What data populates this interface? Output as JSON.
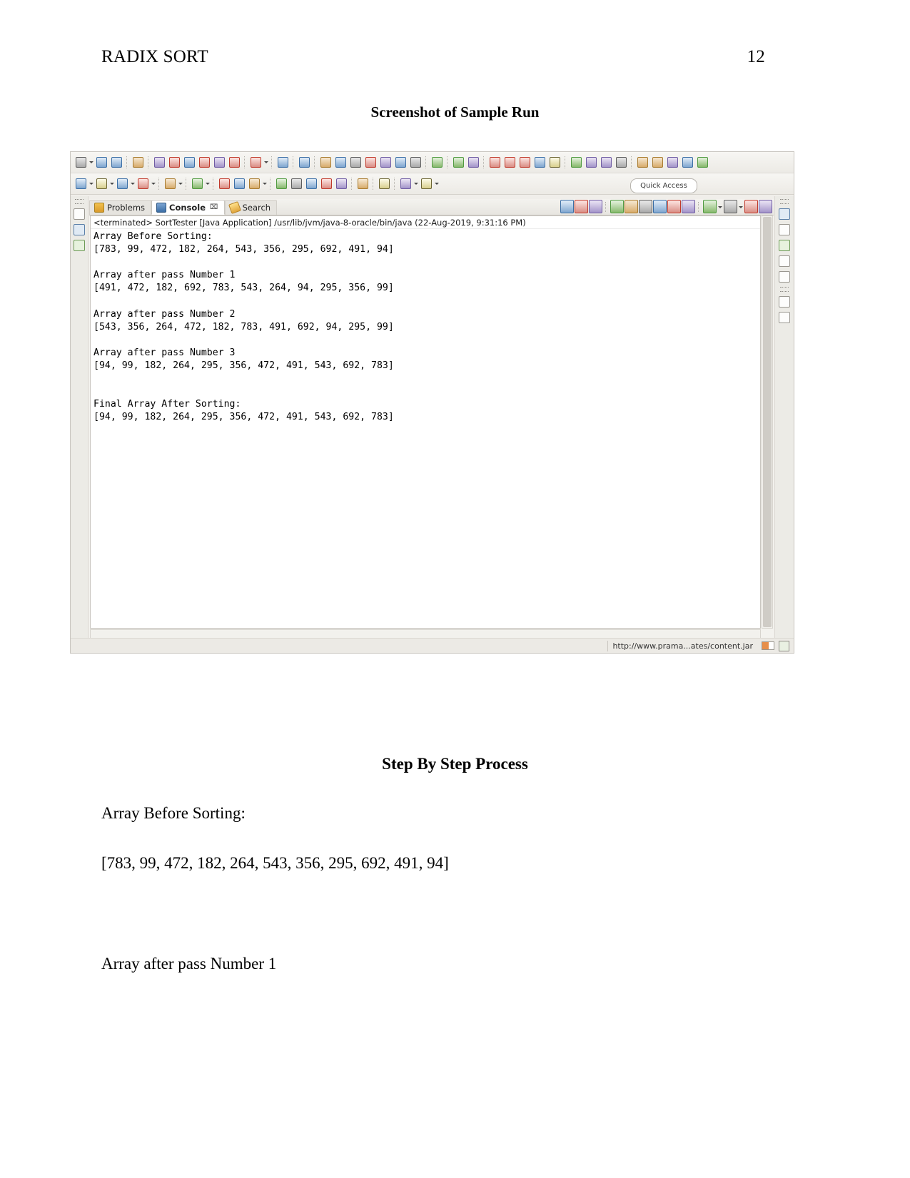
{
  "document": {
    "header": {
      "running_head": "RADIX SORT",
      "page_number": "12"
    },
    "headings": {
      "screenshot": "Screenshot of Sample Run",
      "steps": "Step By Step Process"
    },
    "body": {
      "array_before_label": "Array Before Sorting:",
      "array_before_value": "[783, 99, 472, 182, 264, 543, 356, 295, 692, 491, 94]",
      "pass1_label": "Array after pass Number 1"
    }
  },
  "ide": {
    "quick_access": "Quick Access",
    "tabs": [
      {
        "label": "Problems",
        "icon": "problems-icon",
        "active": false,
        "closable": false
      },
      {
        "label": "Console",
        "icon": "console-icon",
        "active": true,
        "closable": true,
        "close_glyph": "⌧"
      },
      {
        "label": "Search",
        "icon": "search-icon",
        "active": false,
        "closable": false
      }
    ],
    "console": {
      "launch_line": "<terminated> SortTester [Java Application] /usr/lib/jvm/java-8-oracle/bin/java (22-Aug-2019, 9:31:16 PM)",
      "output": "Array Before Sorting:\n[783, 99, 472, 182, 264, 543, 356, 295, 692, 491, 94]\n\nArray after pass Number 1\n[491, 472, 182, 692, 783, 543, 264, 94, 295, 356, 99]\n\nArray after pass Number 2\n[543, 356, 264, 472, 182, 783, 491, 692, 94, 295, 99]\n\nArray after pass Number 3\n[94, 99, 182, 264, 295, 356, 472, 491, 543, 692, 783]\n\n\nFinal Array After Sorting:\n[94, 99, 182, 264, 295, 356, 472, 491, 543, 692, 783]"
    },
    "status": {
      "text": "http://www.prama...ates/content.jar"
    },
    "colors": {
      "toolbar_bg": "#f2f0ec",
      "view_bg": "#f3f2ee",
      "console_bg": "#ffffff",
      "tab_active_bg": "#ffffff",
      "accent_green": "#4f9a3f",
      "accent_red": "#c0392b",
      "accent_blue": "#3b6ea5",
      "accent_orange": "#e78f4a"
    },
    "toolbar_row1_icons": [
      "new-file-icon",
      "dropdown-arrow",
      "save-icon",
      "save-all-icon",
      "sep",
      "print-icon",
      "sep",
      "refresh-icon",
      "build-all-icon",
      "info-icon",
      "properties-icon",
      "new-java-project-icon",
      "new-java-ee-icon",
      "sep",
      "debug-person-icon",
      "dropdown-arrow",
      "sep",
      "terminal-icon",
      "sep",
      "skip-breakpoints-icon",
      "sep",
      "resume-icon",
      "suspend-icon",
      "terminate-icon",
      "disconnect-icon",
      "step-into-icon",
      "step-over-icon",
      "step-return-icon",
      "sep",
      "toggle-wordwrap-icon",
      "sep",
      "open-type-icon",
      "open-task-icon",
      "sep",
      "next-annotation-icon",
      "previous-annotation-icon",
      "last-edit-icon",
      "back-icon",
      "forward-icon",
      "sep",
      "pin-icon",
      "tag-icon",
      "warning-icon",
      "error-icon",
      "sep",
      "link-icon",
      "collapse-icon",
      "expand-icon",
      "filter-icon",
      "sort-icon"
    ],
    "toolbar_row2_icons": [
      "new-wizard-icon",
      "dropdown-arrow",
      "run-icon",
      "dropdown-arrow",
      "debug-icon",
      "dropdown-arrow",
      "coverage-icon",
      "dropdown-arrow",
      "sep",
      "external-tools-icon",
      "dropdown-arrow",
      "sep",
      "git-icon",
      "dropdown-arrow",
      "sep",
      "open-perspective-icon",
      "open-folder-icon",
      "edit-icon",
      "dropdown-arrow",
      "sep",
      "history-icon",
      "run-last-icon",
      "compare-icon",
      "report-icon",
      "table-icon",
      "sep",
      "search-globe-icon",
      "sep",
      "next-edit-icon",
      "sep",
      "back-nav-icon",
      "dropdown-arrow",
      "forward-nav-icon",
      "dropdown-arrow"
    ],
    "view_toolbar_icons": [
      "terminate-icon",
      "remove-launch-icon",
      "remove-all-launches-icon",
      "sep",
      "open-console-icon",
      "pin-console-icon",
      "scroll-lock-icon",
      "word-wrap-icon",
      "display-selected-console-icon",
      "new-console-icon",
      "sep",
      "open-console-menu-icon",
      "dropdown-arrow",
      "view-menu-icon",
      "dropdown-arrow",
      "minimize-icon",
      "maximize-icon"
    ]
  }
}
